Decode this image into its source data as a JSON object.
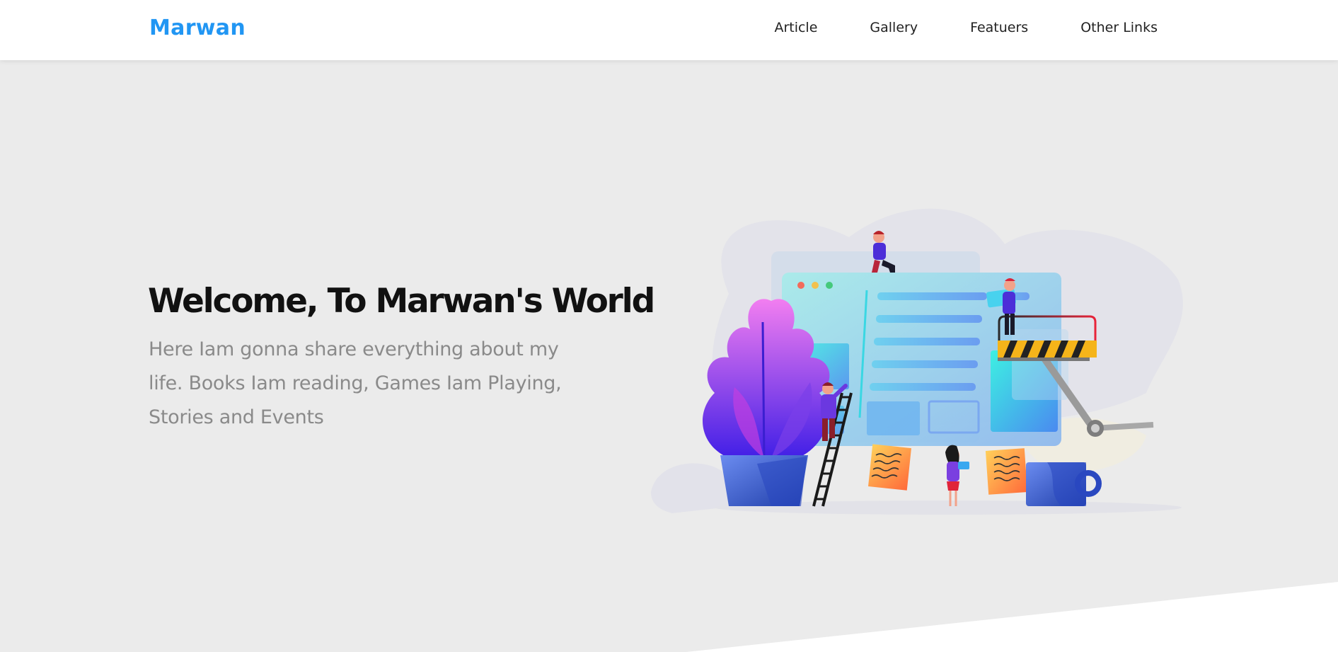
{
  "header": {
    "logo": "Marwan",
    "nav": [
      {
        "label": "Article"
      },
      {
        "label": "Gallery"
      },
      {
        "label": "Featuers"
      },
      {
        "label": "Other Links"
      }
    ]
  },
  "hero": {
    "title": "Welcome, To Marwan's World",
    "description": "Here Iam gonna share everything about my life. Books Iam reading, Games Iam Playing, Stories and Events"
  },
  "colors": {
    "brand": "#2196f3",
    "hero_bg": "#ebebeb",
    "text_dark": "#111111",
    "text_muted": "#8a8a8a"
  }
}
